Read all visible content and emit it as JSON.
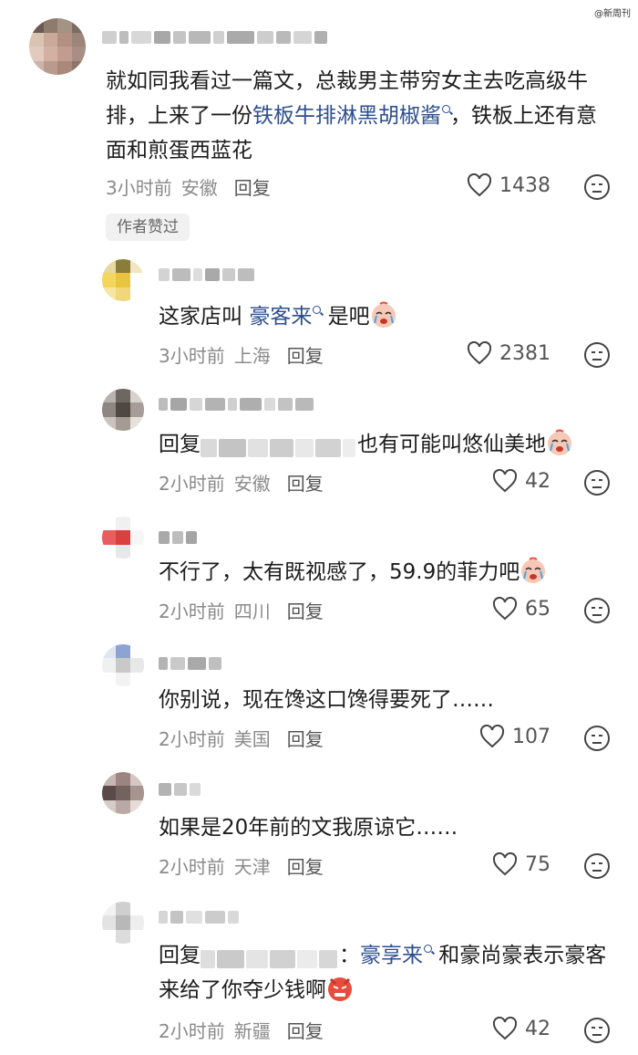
{
  "watermark": "@新周刊",
  "comments": {
    "main": {
      "text_before": "就如同我看过一篇文，总裁男主带穷女主去吃高级牛排，上来了一份",
      "link": "铁板牛排淋黑胡椒酱",
      "text_after": "，铁板上还有意面和煎蛋西蓝花",
      "time": "3小时前",
      "location": "安徽",
      "reply_label": "回复",
      "likes": "1438",
      "badge": "作者赞过"
    },
    "r1": {
      "text_before": "这家店叫 ",
      "link": "豪客来",
      "text_after": " 是吧",
      "time": "3小时前",
      "location": "上海",
      "reply_label": "回复",
      "likes": "2381"
    },
    "r2": {
      "prefix": "回复",
      "text": "也有可能叫悠仙美地",
      "time": "2小时前",
      "location": "安徽",
      "reply_label": "回复",
      "likes": "42"
    },
    "r3": {
      "text": "不行了，太有既视感了，59.9的菲力吧",
      "time": "2小时前",
      "location": "四川",
      "reply_label": "回复",
      "likes": "65"
    },
    "r4": {
      "text": "你别说，现在馋这口馋得要死了……",
      "time": "2小时前",
      "location": "美国",
      "reply_label": "回复",
      "likes": "107"
    },
    "r5": {
      "text": "如果是20年前的文我原谅它……",
      "time": "2小时前",
      "location": "天津",
      "reply_label": "回复",
      "likes": "75"
    },
    "r6": {
      "prefix": "回复",
      "colon": "：",
      "link": "豪享来",
      "text_after": " 和豪尚豪表示豪客来给了你夺少钱啊",
      "time": "2小时前",
      "location": "新疆",
      "reply_label": "回复",
      "likes": "42"
    }
  },
  "colors": {
    "link": "#2d4e8e",
    "meta": "#8a8a8a",
    "text": "#1c1c1c"
  },
  "icons": [
    "heart-outline-icon",
    "dislike-face-icon",
    "search-icon",
    "crying-emoji-icon",
    "angry-emoji-icon"
  ]
}
